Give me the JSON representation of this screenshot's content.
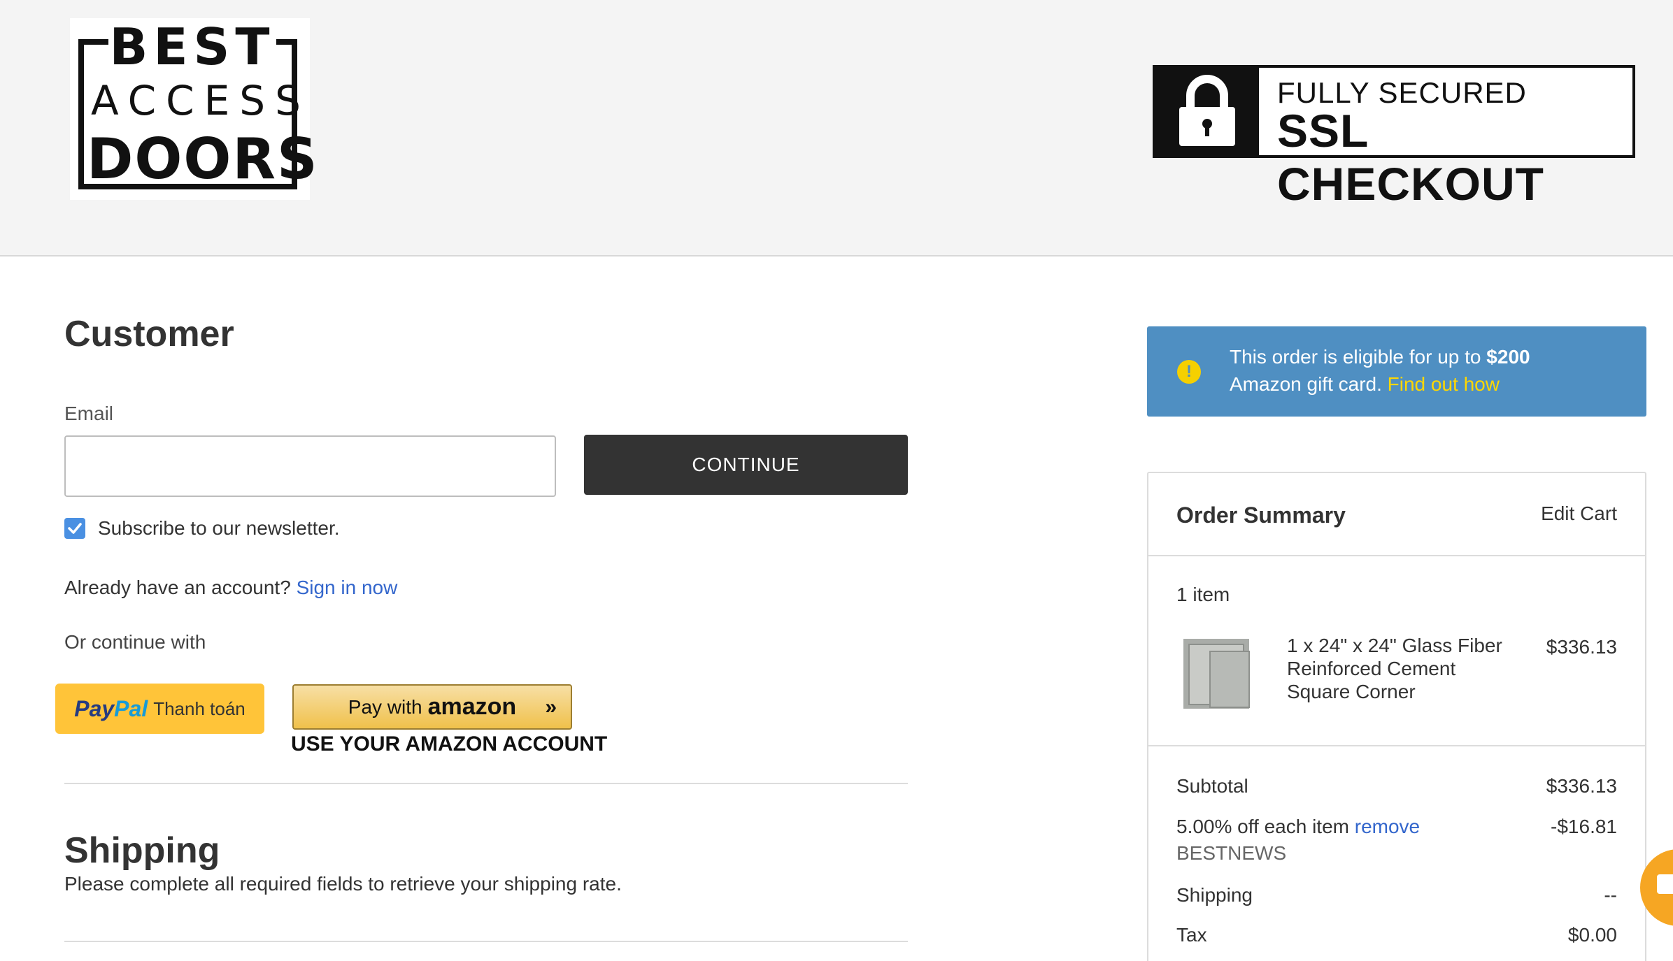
{
  "header": {
    "logo": {
      "line1": "BEST",
      "line2": "ACCESS",
      "line3": "DOORS"
    },
    "ssl_badge": {
      "line1": "FULLY SECURED",
      "line2": "SSL CHECKOUT"
    }
  },
  "customer": {
    "title": "Customer",
    "email_label": "Email",
    "email_value": "",
    "continue_label": "CONTINUE",
    "newsletter_label": "Subscribe to our newsletter.",
    "newsletter_checked": true,
    "account_prompt": "Already have an account?",
    "sign_in_label": "Sign in now",
    "continue_with_label": "Or continue with",
    "paypal": {
      "brand_1": "Pay",
      "brand_2": "Pal",
      "label": "Thanh toán"
    },
    "amazon": {
      "prefix": "Pay with",
      "brand": "amazon",
      "arrows": "»",
      "caption": "USE YOUR AMAZON ACCOUNT"
    }
  },
  "shipping": {
    "title": "Shipping",
    "message": "Please complete all required fields to retrieve your shipping rate."
  },
  "notice": {
    "icon": "!",
    "text_1": "This order is eligible for up to",
    "amount": "$200",
    "text_2": "Amazon gift card.",
    "link": "Find out how"
  },
  "order_summary": {
    "title": "Order Summary",
    "edit_cart_label": "Edit Cart",
    "item_count": "1 item",
    "items": [
      {
        "line1": "1 x 24\" x 24\" Glass Fiber",
        "line2": "Reinforced Cement",
        "line3": "Square Corner",
        "price": "$336.13"
      }
    ],
    "subtotal_label": "Subtotal",
    "subtotal_value": "$336.13",
    "discount_label": "5.00% off each item",
    "discount_remove": "remove",
    "discount_value": "-$16.81",
    "coupon_code": "BESTNEWS",
    "shipping_label": "Shipping",
    "shipping_value": "--",
    "tax_label": "Tax",
    "tax_value": "$0.00"
  },
  "colors": {
    "accent": "#3366cc",
    "notice_bg": "#4f8fc2",
    "continue_bg": "#333333",
    "paypal_bg": "#ffc439",
    "gold_link": "#ffd700"
  }
}
